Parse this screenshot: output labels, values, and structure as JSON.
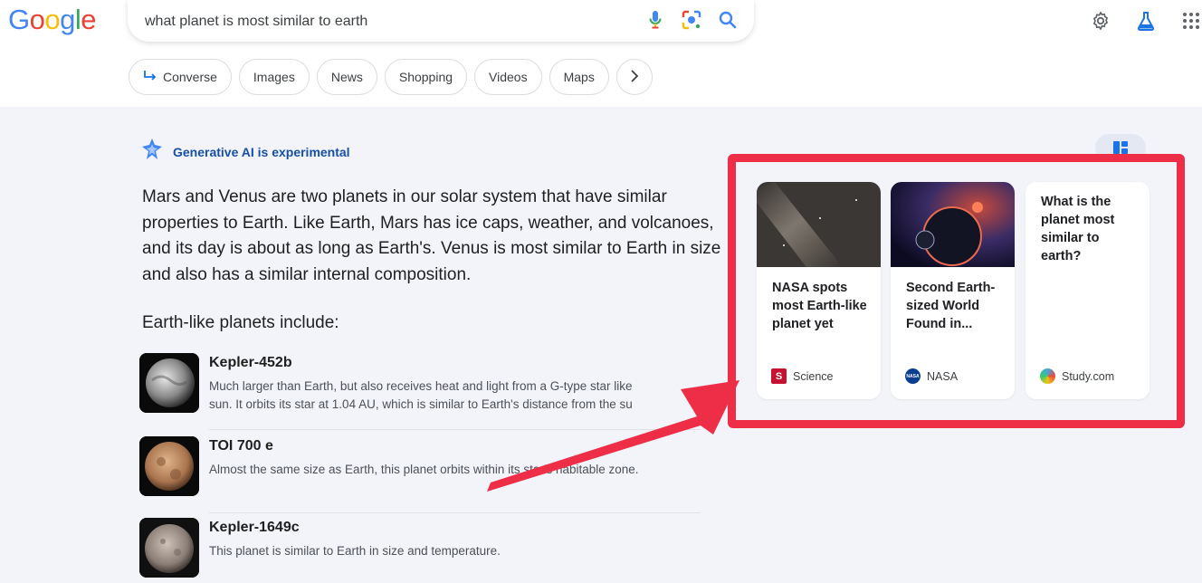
{
  "header": {
    "logo_letters": [
      "G",
      "o",
      "o",
      "g",
      "l",
      "e"
    ],
    "logo_colors": [
      "#4285f4",
      "#ea4335",
      "#fbbc05",
      "#4285f4",
      "#34a853",
      "#ea4335"
    ],
    "search_query": "what planet is most similar to earth",
    "icons": [
      "mic-icon",
      "lens-icon",
      "search-icon",
      "gear-icon",
      "labs-flask-icon",
      "apps-grid-icon"
    ]
  },
  "chips": [
    {
      "label": "Converse",
      "icon": "converse-arrow-icon"
    },
    {
      "label": "Images"
    },
    {
      "label": "News"
    },
    {
      "label": "Shopping"
    },
    {
      "label": "Videos"
    },
    {
      "label": "Maps"
    }
  ],
  "ai": {
    "badge_label": "Generative AI is experimental",
    "summary": "Mars and Venus are two planets in our solar system that have similar properties to Earth. Like Earth, Mars has ice caps, weather, and volcanoes, and its day is about as long as Earth's. Venus is most similar to Earth in size and also has a similar internal composition.",
    "list_heading": "Earth-like planets include:"
  },
  "planets": [
    {
      "name": "Kepler-452b",
      "desc_line1": "Much larger than Earth, but also receives heat and light from a G-type star like",
      "desc_line2": "sun. It orbits its star at 1.04 AU, which is similar to Earth's distance from the su"
    },
    {
      "name": "TOI 700 e",
      "desc_line1": "Almost the same size as Earth, this planet orbits within its star's habitable zone."
    },
    {
      "name": "Kepler-1649c",
      "desc_line1": "This planet is similar to Earth in size and temperature."
    }
  ],
  "source_cards": [
    {
      "title": "NASA spots most Earth-like planet yet",
      "source": "Science",
      "source_icon": "S"
    },
    {
      "title": "Second Earth-sized World Found in...",
      "source": "NASA",
      "source_icon": "NASA"
    },
    {
      "title": "What is the planet most similar to earth?",
      "source": "Study.com",
      "source_icon": ""
    }
  ],
  "colors": {
    "highlight_red": "#ee2e46",
    "ai_blue": "#174ea6"
  }
}
